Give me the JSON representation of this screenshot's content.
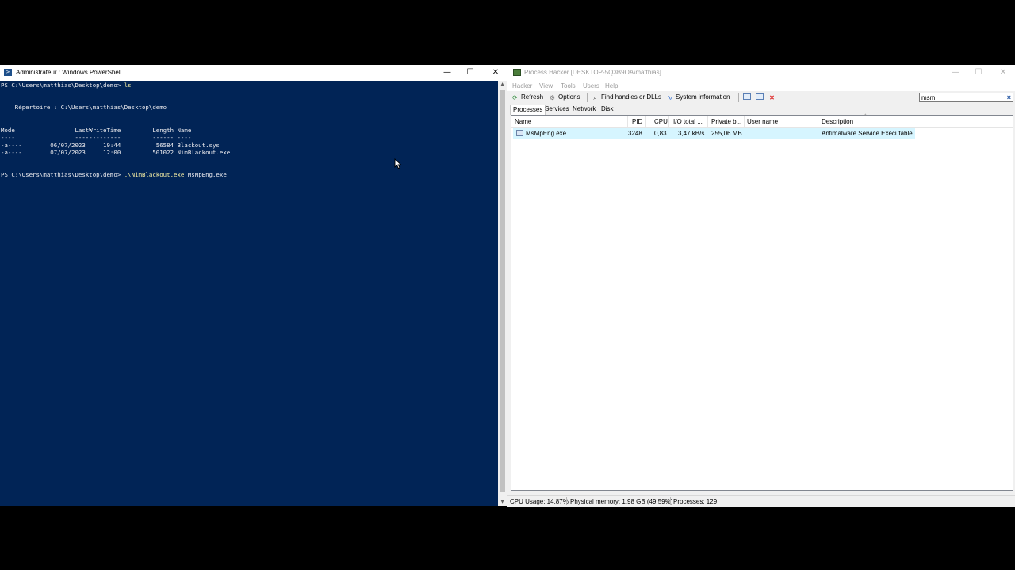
{
  "powershell": {
    "title": "Administrateur : Windows PowerShell",
    "icon": "powershell-icon",
    "lines": [
      {
        "prompt": "PS C:\\Users\\matthias\\Desktop\\demo> ",
        "cmd": "ls",
        "args": ""
      },
      {
        "text": ""
      },
      {
        "text": ""
      },
      {
        "text": "    Répertoire : C:\\Users\\matthias\\Desktop\\demo"
      },
      {
        "text": ""
      },
      {
        "text": ""
      },
      {
        "text": "Mode                 LastWriteTime         Length Name"
      },
      {
        "text": "----                 -------------         ------ ----"
      },
      {
        "text": "-a----        06/07/2023     19:44          56584 Blackout.sys"
      },
      {
        "text": "-a----        07/07/2023     12:00         501022 NimBlackout.exe"
      },
      {
        "text": ""
      },
      {
        "text": ""
      },
      {
        "prompt": "PS C:\\Users\\matthias\\Desktop\\demo> ",
        "cmd": ".\\NimBlackout.exe",
        "args": " MsMpEng.exe"
      }
    ]
  },
  "process_hacker": {
    "title": "Process Hacker [DESKTOP-5Q3B9OA\\matthias]",
    "menu": [
      "Hacker",
      "View",
      "Tools",
      "Users",
      "Help"
    ],
    "toolbar": {
      "refresh": "Refresh",
      "options": "Options",
      "find_handles": "Find handles or DLLs",
      "system_information": "System information"
    },
    "search_value": "msm",
    "tabs": [
      "Processes",
      "Services",
      "Network",
      "Disk"
    ],
    "columns": [
      "Name",
      "PID",
      "CPU",
      "I/O total ...",
      "Private b...",
      "User name",
      "Description"
    ],
    "processes": [
      {
        "name": "MsMpEng.exe",
        "pid": "3248",
        "cpu": "0,83",
        "io_total": "3,47 kB/s",
        "private_bytes": "255,06 MB",
        "user_name": "",
        "description": "Antimalware Service Executable"
      }
    ],
    "status": {
      "cpu_usage": "CPU Usage: 14.87%",
      "physical_memory": "Physical memory: 1,98 GB (49.59%)",
      "processes": "Processes: 129"
    },
    "highlight_color": "#d6f5ff"
  },
  "colors": {
    "console_bg": "#012456",
    "console_fg": "#eeedf0",
    "console_cmd": "#f9f1a5"
  }
}
